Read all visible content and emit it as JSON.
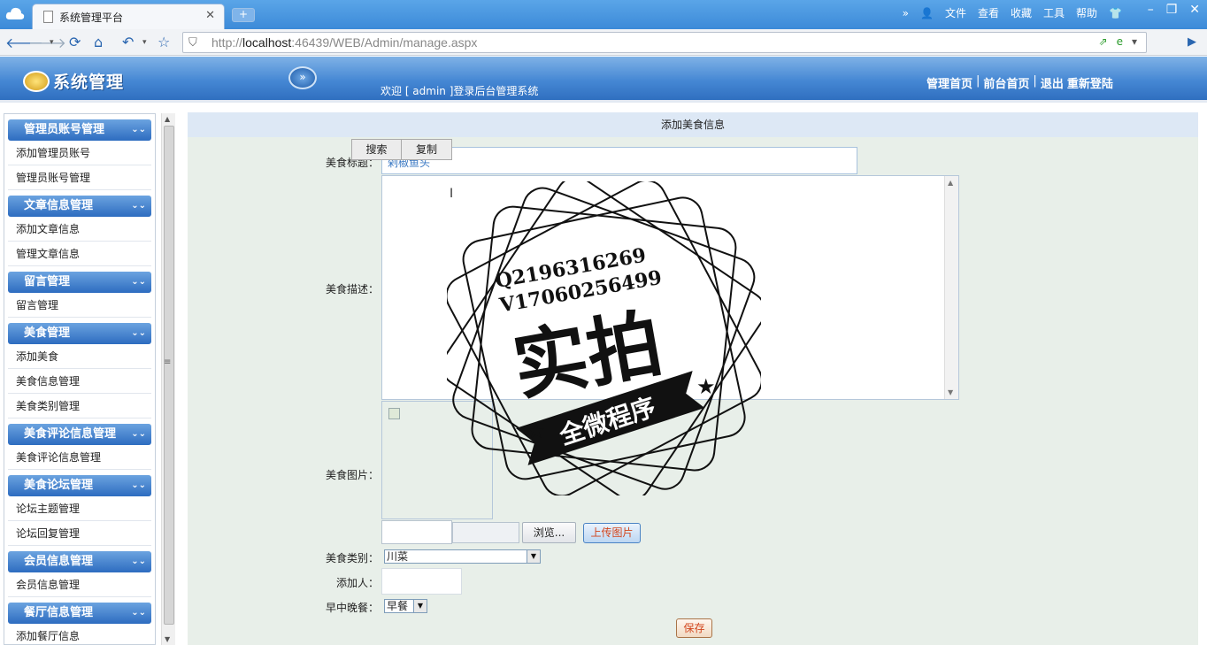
{
  "browser": {
    "tab_title": "系统管理平台",
    "url_prefix": "http://",
    "url_host": "localhost",
    "url_rest": ":46439/WEB/Admin/manage.aspx",
    "menu": [
      "文件",
      "查看",
      "收藏",
      "工具",
      "帮助"
    ]
  },
  "app": {
    "logo_text": "系统管理",
    "welcome": "欢迎 [ admin ]登录后台管理系统",
    "links": [
      "管理首页",
      "前台首页",
      "退出",
      "重新登陆"
    ]
  },
  "sidebar": {
    "groups": [
      {
        "title": "管理员账号管理",
        "items": [
          "添加管理员账号",
          "管理员账号管理"
        ]
      },
      {
        "title": "文章信息管理",
        "items": [
          "添加文章信息",
          "管理文章信息"
        ]
      },
      {
        "title": "留言管理",
        "items": [
          "留言管理"
        ]
      },
      {
        "title": "美食管理",
        "items": [
          "添加美食",
          "美食信息管理",
          "美食类别管理"
        ]
      },
      {
        "title": "美食评论信息管理",
        "items": [
          "美食评论信息管理"
        ]
      },
      {
        "title": "美食论坛管理",
        "items": [
          "论坛主题管理",
          "论坛回复管理"
        ]
      },
      {
        "title": "会员信息管理",
        "items": [
          "会员信息管理"
        ]
      },
      {
        "title": "餐厅信息管理",
        "items": [
          "添加餐厅信息"
        ]
      }
    ]
  },
  "form": {
    "heading": "添加美食信息",
    "title_label": "美食标题：",
    "title_value": "剁椒鱼头",
    "context_menu": [
      "搜索",
      "复制"
    ],
    "desc_label": "美食描述：",
    "image_label": "美食图片：",
    "browse_label": "浏览...",
    "upload_label": "上传图片",
    "category_label": "美食类别：",
    "category_value": "川菜",
    "adder_label": "添加人：",
    "meal_label": "早中晚餐：",
    "meal_value": "早餐",
    "save_label": "保存"
  },
  "watermark": {
    "line1": "Q2196316269",
    "line2": "V17060256499",
    "big": "实拍",
    "ribbon": "全微程序"
  }
}
